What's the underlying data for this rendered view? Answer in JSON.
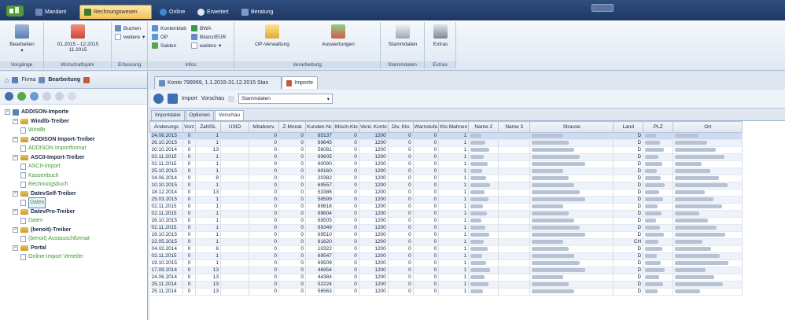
{
  "topbar": {
    "tabs": [
      {
        "label": "Mandant",
        "color": "#6d86b5"
      },
      {
        "label": "Rechnungswesen",
        "color": "#3d7a2e"
      },
      {
        "label": "Online",
        "color": "#3b8ad0"
      },
      {
        "label": "Erweitert",
        "color": "#e0e6ef"
      },
      {
        "label": "Beratung",
        "color": "#7a9acb"
      }
    ],
    "active_tab": "Rechnungswesen"
  },
  "ribbon": {
    "groups": {
      "vorgaenge": {
        "label": "Vorgänge",
        "button": "Bearbeiten"
      },
      "wirtschaftsjahr": {
        "label": "Wirtschaftsjahr",
        "period": "01.2015 - 12.2015",
        "sub": "11.2015"
      },
      "erfassung": {
        "label": "Erfassung",
        "items": [
          "Buchen",
          "weitere"
        ]
      },
      "infos": {
        "label": "Infos",
        "col1": [
          "Kontenblatt",
          "OP",
          "Salden"
        ],
        "col2": [
          "BWA",
          "Bilanz/EÜR",
          "weitere"
        ]
      },
      "verarbeitung": {
        "label": "Verarbeitung",
        "items": [
          "OP-Verwaltung",
          "Auswertungen"
        ]
      },
      "stammdaten": {
        "label": "Stammdaten",
        "item": "Stammdaten"
      },
      "extras": {
        "label": "Extras",
        "item": "Extras"
      }
    }
  },
  "left": {
    "tabs": [
      "Firma",
      "Bearbeitung"
    ],
    "tree": [
      {
        "level": 0,
        "type": "root",
        "label": "ADDISON-Importe"
      },
      {
        "level": 1,
        "type": "folder",
        "label": "Windlb-Treiber"
      },
      {
        "level": 2,
        "type": "leaf",
        "label": "Windlb"
      },
      {
        "level": 1,
        "type": "folder",
        "label": "ADDISON Import-Treiber"
      },
      {
        "level": 2,
        "type": "leaf",
        "label": "ADDISON Importformat"
      },
      {
        "level": 1,
        "type": "folder",
        "label": "ASCII-Import-Treiber"
      },
      {
        "level": 2,
        "type": "leaf",
        "label": "ASCII-Import"
      },
      {
        "level": 2,
        "type": "leaf",
        "label": "Kassenbuch"
      },
      {
        "level": 2,
        "type": "leaf",
        "label": "Rechnungsbuch"
      },
      {
        "level": 1,
        "type": "folder",
        "label": "DatevSelf-Treiber"
      },
      {
        "level": 2,
        "type": "leaf",
        "label": "Datev",
        "selected": true
      },
      {
        "level": 1,
        "type": "folder",
        "label": "DatevPro-Treiber"
      },
      {
        "level": 2,
        "type": "leaf",
        "label": "Datev"
      },
      {
        "level": 1,
        "type": "folder",
        "label": "(benoit)-Treiber"
      },
      {
        "level": 2,
        "type": "leaf",
        "label": "(benoit) Austauschformat"
      },
      {
        "level": 1,
        "type": "folder",
        "label": "Portal"
      },
      {
        "level": 2,
        "type": "leaf",
        "label": "Online-Import Verteiler"
      }
    ]
  },
  "doc": {
    "tabs": [
      "Konto 799999, 1.1.2015-31.12.2015 Stan",
      "Importe"
    ],
    "active_tab": "Importe",
    "toolbar": {
      "import": "Import",
      "vorschau": "Vorschau",
      "stammdaten": "Stammdaten"
    },
    "inner_tabs": [
      "Importdatei",
      "Optionen",
      "Vorschau"
    ],
    "active_inner": "Vorschau"
  },
  "grid": {
    "columns": [
      "Änderungs",
      "Vorz",
      "ZahlSL",
      "USID",
      "Mitabrerv.",
      "Z-Monat",
      "Kunden-Nr.",
      "Misch-Kto",
      "Verd. Konto",
      "Div. Kto",
      "Warnstufe",
      "Kto Mahnen",
      "Name 2",
      "Name 3",
      "Strasse",
      "Land",
      "PLZ",
      "Ort"
    ],
    "rows": [
      [
        "24.08.2015",
        "0",
        "1",
        "",
        "0",
        "0",
        "85137",
        "0",
        "1200",
        "0",
        "0",
        "1",
        "",
        "",
        "",
        "D",
        "",
        ""
      ],
      [
        "26.10.2015",
        "0",
        "1",
        "",
        "0",
        "0",
        "69645",
        "0",
        "1200",
        "0",
        "0",
        "1",
        "",
        "",
        "",
        "D",
        "",
        ""
      ],
      [
        "20.10.2014",
        "0",
        "13",
        "",
        "0",
        "0",
        "56081",
        "0",
        "1200",
        "0",
        "0",
        "1",
        "",
        "",
        "",
        "D",
        "",
        ""
      ],
      [
        "02.11.2015",
        "0",
        "1",
        "",
        "0",
        "0",
        "69605",
        "0",
        "1200",
        "0",
        "0",
        "1",
        "",
        "",
        "",
        "D",
        "",
        ""
      ],
      [
        "02.11.2015",
        "0",
        "1",
        "",
        "0",
        "0",
        "60090",
        "0",
        "1200",
        "0",
        "0",
        "1",
        "",
        "",
        "",
        "D",
        "",
        ""
      ],
      [
        "25.10.2015",
        "0",
        "1",
        "",
        "0",
        "0",
        "69160",
        "0",
        "1200",
        "0",
        "0",
        "1",
        "",
        "",
        "",
        "D",
        "",
        ""
      ],
      [
        "04.06.2014",
        "0",
        "8",
        "",
        "0",
        "0",
        "20382",
        "0",
        "1200",
        "0",
        "0",
        "1",
        "",
        "",
        "",
        "D",
        "",
        ""
      ],
      [
        "10.10.2015",
        "0",
        "1",
        "",
        "0",
        "0",
        "69557",
        "0",
        "1200",
        "0",
        "0",
        "1",
        "",
        "",
        "",
        "D",
        "",
        ""
      ],
      [
        "18.12.2014",
        "0",
        "13",
        "",
        "0",
        "0",
        "53386",
        "0",
        "1200",
        "0",
        "0",
        "1",
        "",
        "",
        "",
        "D",
        "",
        ""
      ],
      [
        "25.03.2015",
        "0",
        "1",
        "",
        "0",
        "0",
        "58599",
        "0",
        "1200",
        "0",
        "0",
        "1",
        "",
        "",
        "",
        "D",
        "",
        ""
      ],
      [
        "02.11.2015",
        "0",
        "1",
        "",
        "0",
        "0",
        "69616",
        "0",
        "1200",
        "0",
        "0",
        "1",
        "",
        "",
        "",
        "D",
        "",
        ""
      ],
      [
        "02.11.2015",
        "0",
        "1",
        "",
        "0",
        "0",
        "69604",
        "0",
        "1200",
        "0",
        "0",
        "1",
        "",
        "",
        "",
        "D",
        "",
        ""
      ],
      [
        "26.10.2015",
        "0",
        "1",
        "",
        "0",
        "0",
        "69505",
        "0",
        "1200",
        "0",
        "0",
        "1",
        "",
        "",
        "",
        "D",
        "",
        ""
      ],
      [
        "02.11.2015",
        "0",
        "1",
        "",
        "0",
        "0",
        "69349",
        "0",
        "1200",
        "0",
        "0",
        "1",
        "",
        "",
        "",
        "D",
        "",
        ""
      ],
      [
        "19.10.2015",
        "0",
        "1",
        "",
        "0",
        "0",
        "69510",
        "0",
        "1200",
        "0",
        "0",
        "1",
        "",
        "",
        "",
        "D",
        "",
        ""
      ],
      [
        "22.05.2015",
        "0",
        "1",
        "",
        "0",
        "0",
        "61620",
        "0",
        "1200",
        "0",
        "0",
        "1",
        "",
        "",
        "",
        "CH",
        "",
        ""
      ],
      [
        "04.02.2014",
        "0",
        "8",
        "",
        "0",
        "0",
        "10322",
        "0",
        "1200",
        "0",
        "0",
        "1",
        "",
        "",
        "",
        "D",
        "",
        ""
      ],
      [
        "02.11.2015",
        "0",
        "1",
        "",
        "0",
        "0",
        "69547",
        "0",
        "1200",
        "0",
        "0",
        "1",
        "",
        "",
        "",
        "D",
        "",
        ""
      ],
      [
        "19.10.2015",
        "0",
        "1",
        "",
        "0",
        "0",
        "69509",
        "0",
        "1200",
        "0",
        "0",
        "1",
        "",
        "",
        "",
        "D",
        "",
        ""
      ],
      [
        "17.09.2014",
        "0",
        "13",
        "",
        "0",
        "0",
        "46954",
        "0",
        "1200",
        "0",
        "0",
        "1",
        "",
        "",
        "",
        "D",
        "",
        ""
      ],
      [
        "24.06.2014",
        "0",
        "13",
        "",
        "0",
        "0",
        "44384",
        "0",
        "1200",
        "0",
        "0",
        "1",
        "",
        "",
        "",
        "D",
        "",
        ""
      ],
      [
        "25.11.2014",
        "0",
        "13",
        "",
        "0",
        "0",
        "52224",
        "0",
        "1200",
        "0",
        "0",
        "1",
        "",
        "",
        "",
        "D",
        "",
        ""
      ],
      [
        "25.11.2014",
        "0",
        "13",
        "",
        "0",
        "0",
        "56563",
        "0",
        "1200",
        "0",
        "0",
        "1",
        "",
        "",
        "",
        "D",
        "",
        ""
      ]
    ]
  }
}
